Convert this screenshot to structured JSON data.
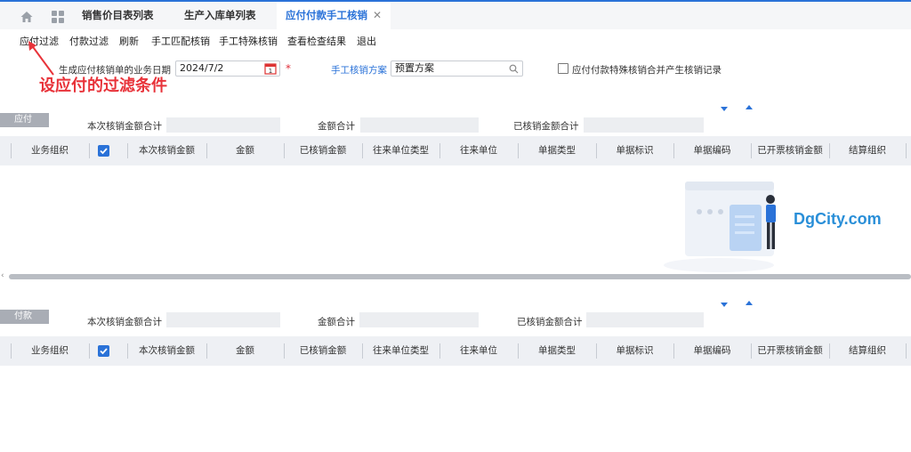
{
  "tabs": [
    {
      "label": "销售价目表列表"
    },
    {
      "label": "生产入库单列表"
    },
    {
      "label": "应付付款手工核销",
      "close": "✕"
    }
  ],
  "toolbar": [
    "应付过滤",
    "付款过滤",
    "刷新",
    "手工匹配核销",
    "手工特殊核销",
    "查看检查结果",
    "退出"
  ],
  "annotation": "设应付的过滤条件",
  "form": {
    "date_label": "生成应付核销单的业务日期",
    "date_value": "2024/7/2",
    "required_mark": "*",
    "plan_label": "手工核销方案",
    "plan_value": "预置方案",
    "special_checkbox_label": "应付付款特殊核销合并产生核销记录"
  },
  "payable": {
    "tag": "应付",
    "sum1_label": "本次核销金额合计",
    "sum2_label": "金额合计",
    "sum3_label": "已核销金额合计"
  },
  "payment": {
    "tag": "付款",
    "sum1_label": "本次核销金额合计",
    "sum2_label": "金额合计",
    "sum3_label": "已核销金额合计"
  },
  "columns": [
    "业务组织",
    "本次核销金额",
    "金额",
    "已核销金额",
    "往来单位类型",
    "往来单位",
    "单据类型",
    "单据标识",
    "单据编码",
    "已开票核销金额",
    "结算组织"
  ],
  "watermark": "DgCity.com",
  "colors": {
    "accent": "#2a72d8",
    "annotation": "#e8333a"
  }
}
